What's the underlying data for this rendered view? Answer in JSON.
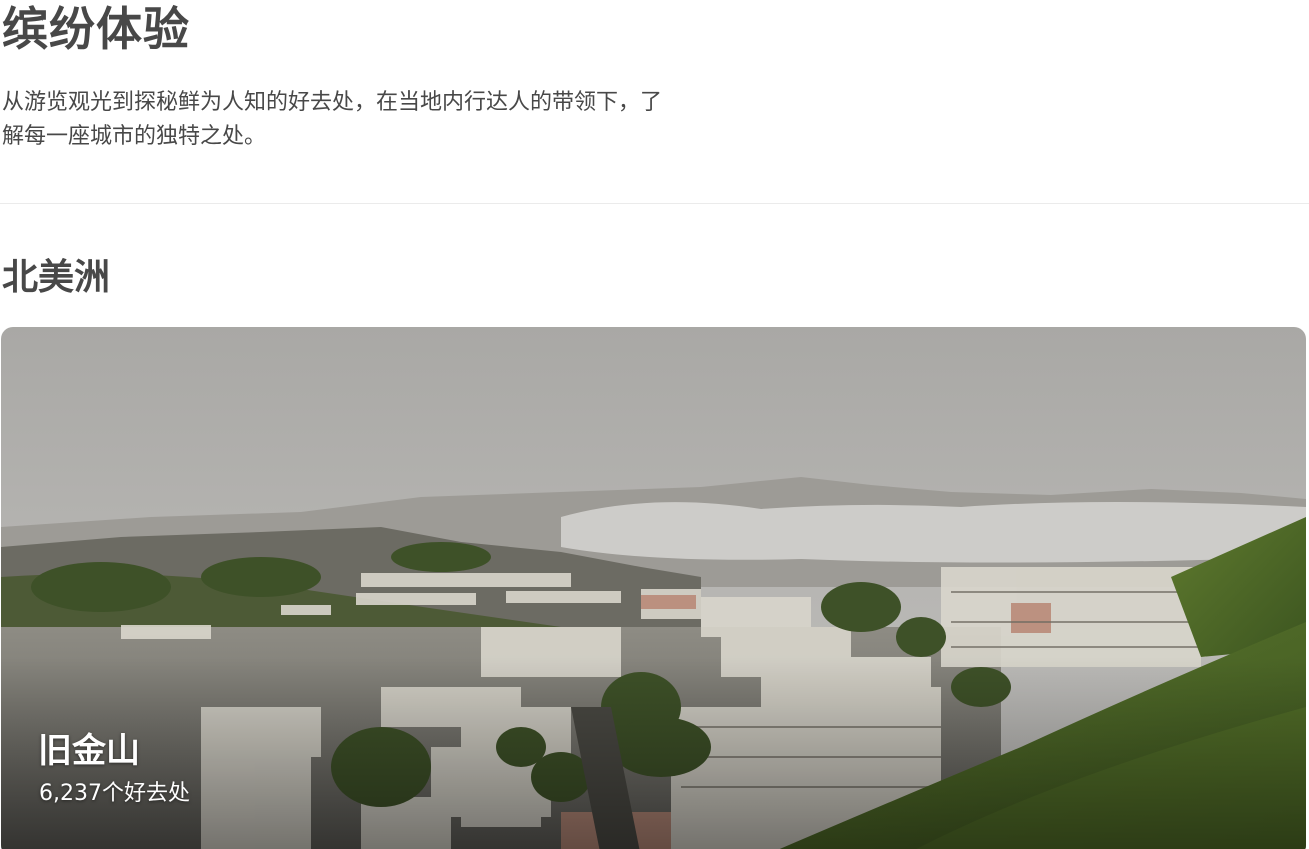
{
  "hero": {
    "title": "缤纷体验",
    "description": "从游览观光到探秘鲜为人知的好去处，在当地内行达人的带领下，了解每一座城市的独特之处。"
  },
  "region": {
    "title": "北美洲"
  },
  "city_card": {
    "name": "旧金山",
    "count_label": "6,237个好去处"
  },
  "colors": {
    "text": "#484848",
    "divider": "#ebebeb",
    "card_text": "#ffffff"
  }
}
